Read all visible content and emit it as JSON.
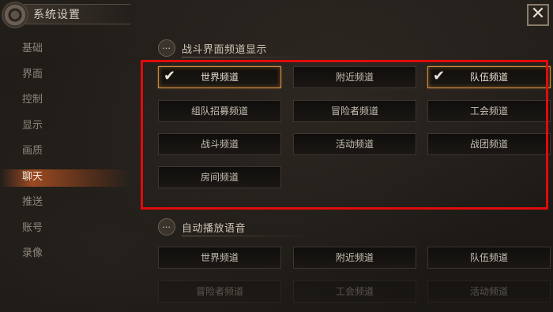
{
  "window": {
    "title": "系统设置",
    "close_label": "✕"
  },
  "sidebar": {
    "items": [
      {
        "label": "基础"
      },
      {
        "label": "界面"
      },
      {
        "label": "控制"
      },
      {
        "label": "显示"
      },
      {
        "label": "画质"
      },
      {
        "label": "聊天",
        "active": true
      },
      {
        "label": "推送"
      },
      {
        "label": "账号"
      },
      {
        "label": "录像"
      }
    ]
  },
  "battle_channels": {
    "title": "战斗界面频道显示",
    "options": [
      {
        "label": "世界频道",
        "checked": true
      },
      {
        "label": "附近频道",
        "checked": false
      },
      {
        "label": "队伍频道",
        "checked": true
      },
      {
        "label": "组队招募频道",
        "checked": false
      },
      {
        "label": "冒险者频道",
        "checked": false
      },
      {
        "label": "工会频道",
        "checked": false
      },
      {
        "label": "战斗频道",
        "checked": false
      },
      {
        "label": "活动频道",
        "checked": false
      },
      {
        "label": "战团频道",
        "checked": false
      },
      {
        "label": "房间频道",
        "checked": false
      }
    ]
  },
  "auto_voice": {
    "title": "自动播放语音",
    "options": [
      {
        "label": "世界频道",
        "checked": false
      },
      {
        "label": "附近频道",
        "checked": false
      },
      {
        "label": "队伍频道",
        "checked": false
      },
      {
        "label": "冒险者频道",
        "checked": false
      },
      {
        "label": "工会频道",
        "checked": false
      },
      {
        "label": "活动频道",
        "checked": false
      }
    ]
  },
  "icons": {
    "settings": "gear-icon",
    "chat": "chat-bubble-icon",
    "check": "checkmark-icon",
    "close": "close-icon"
  },
  "colors": {
    "highlight_box": "#e10b0b",
    "active_glow": "#ff6e28",
    "checked_border": "#c98a3f"
  }
}
